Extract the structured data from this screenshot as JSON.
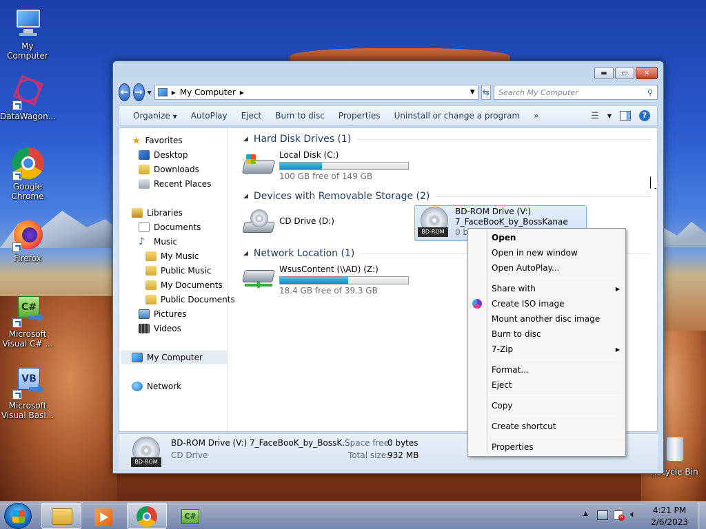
{
  "desktop": {
    "icons": [
      {
        "label": "My Computer"
      },
      {
        "label": "DataWagon..."
      },
      {
        "label": "Google Chrome"
      },
      {
        "label": "Firefox"
      },
      {
        "label": "Microsoft Visual C# ..."
      },
      {
        "label": "Microsoft Visual Basi..."
      },
      {
        "label": "Recycle Bin"
      }
    ]
  },
  "window": {
    "address": {
      "path": "My Computer"
    },
    "search": {
      "placeholder": "Search My Computer"
    },
    "toolbar": {
      "organize": "Organize",
      "autoplay": "AutoPlay",
      "eject": "Eject",
      "burn": "Burn to disc",
      "properties": "Properties",
      "uninstall": "Uninstall or change a program",
      "more": "»"
    },
    "nav": {
      "favorites": "Favorites",
      "desktop": "Desktop",
      "downloads": "Downloads",
      "recent": "Recent Places",
      "libraries": "Libraries",
      "documents": "Documents",
      "music": "Music",
      "my_music": "My Music",
      "public_music": "Public Music",
      "my_documents": "My Documents",
      "public_documents": "Public Documents",
      "pictures": "Pictures",
      "videos": "Videos",
      "my_computer": "My Computer",
      "network": "Network"
    },
    "groups": {
      "hdd": "Hard Disk Drives (1)",
      "removable": "Devices with Removable Storage (2)",
      "network": "Network Location (1)"
    },
    "drives": {
      "c": {
        "name": "Local Disk (C:)",
        "free": "100 GB free of 149 GB",
        "used_fraction": 0.33
      },
      "d": {
        "name": "CD Drive (D:)"
      },
      "v": {
        "name": "BD-ROM Drive (V:)",
        "label": "7_FaceBooK_by_BossKanae",
        "free": "0 by",
        "badge": "BD-ROM"
      },
      "z": {
        "name": "WsusContent (\\\\AD) (Z:)",
        "free": "18.4 GB free of 39.3 GB",
        "used_fraction": 0.53
      }
    },
    "status": {
      "title": "BD-ROM Drive (V:) 7_FaceBooK_by_BossK...",
      "type": "CD Drive",
      "space_free_label": "Space free:",
      "space_free": "0 bytes",
      "total_size_label": "Total size:",
      "total_size": "932 MB",
      "badge": "BD-ROM"
    }
  },
  "context_menu": {
    "open": "Open",
    "open_new": "Open in new window",
    "open_autoplay": "Open AutoPlay...",
    "share_with": "Share with",
    "create_iso": "Create ISO image",
    "mount": "Mount another disc image",
    "burn": "Burn to disc",
    "seven_zip": "7-Zip",
    "format": "Format...",
    "eject": "Eject",
    "copy": "Copy",
    "create_shortcut": "Create shortcut",
    "properties": "Properties",
    "submenu_arrow": "▶"
  },
  "taskbar": {
    "time": "4:21 PM",
    "date": "2/6/2023"
  },
  "colors": {
    "accent": "#1e395b",
    "bar_fill": "#1586c4"
  }
}
